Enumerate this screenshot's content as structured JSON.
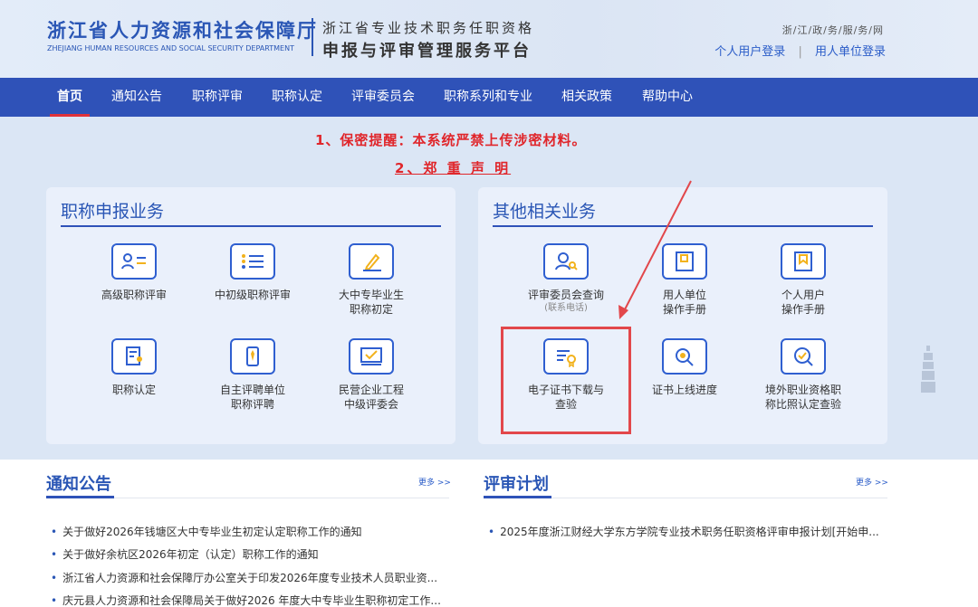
{
  "header": {
    "org_cn": "浙江省人力资源和社会保障厅",
    "org_en": "ZHEJIANG HUMAN RESOURCES AND SOCIAL SECURITY DEPARTMENT",
    "subtitle_line1": "浙江省专业技术职务任职资格",
    "subtitle_line2": "申报与评审管理服务平台",
    "portal_link": "浙/江/政/务/服/务/网",
    "personal_login": "个人用户登录",
    "separator": "|",
    "unit_login": "用人单位登录"
  },
  "nav": {
    "items": [
      {
        "label": "首页"
      },
      {
        "label": "通知公告"
      },
      {
        "label": "职称评审"
      },
      {
        "label": "职称认定"
      },
      {
        "label": "评审委员会"
      },
      {
        "label": "职称系列和专业"
      },
      {
        "label": "相关政策"
      },
      {
        "label": "帮助中心"
      }
    ]
  },
  "notices": {
    "line1": "1、保密提醒：本系统严禁上传涉密材料。",
    "line2": "2、郑 重 声 明"
  },
  "panels": {
    "left": {
      "title": "职称申报业务",
      "items": [
        {
          "label": "高级职称评审",
          "icon": "id-card-icon"
        },
        {
          "label": "中初级职称评审",
          "icon": "list-icon"
        },
        {
          "label": "大中专毕业生\n职称初定",
          "icon": "edit-icon"
        },
        {
          "label": "职称认定",
          "icon": "document-person-icon"
        },
        {
          "label": "自主评聘单位\n职称评聘",
          "icon": "tie-icon"
        },
        {
          "label": "民营企业工程\n中级评委会",
          "icon": "check-board-icon"
        }
      ]
    },
    "right": {
      "title": "其他相关业务",
      "items": [
        {
          "label": "评审委员会查询",
          "note": "(联系电话)",
          "icon": "user-search-icon"
        },
        {
          "label": "用人单位\n操作手册",
          "icon": "book-icon"
        },
        {
          "label": "个人用户\n操作手册",
          "icon": "bookmark-icon"
        },
        {
          "label": "电子证书下载与\n查验",
          "icon": "certificate-icon"
        },
        {
          "label": "证书上线进度",
          "icon": "magnifier-icon"
        },
        {
          "label": "境外职业资格职\n称比照认定查验",
          "icon": "search-check-icon"
        }
      ]
    }
  },
  "sections": {
    "notices": {
      "title": "通知公告",
      "more": "更多 >>",
      "items": [
        "关于做好2026年钱塘区大中专毕业生初定认定职称工作的通知",
        "关于做好余杭区2026年初定（认定）职称工作的通知",
        "浙江省人力资源和社会保障厅办公室关于印发2026年度专业技术人员职业资...",
        "庆元县人力资源和社会保障局关于做好2026 年度大中专毕业生职称初定工作..."
      ]
    },
    "plans": {
      "title": "评审计划",
      "more": "更多 >>",
      "items": [
        "2025年度浙江财经大学东方学院专业技术职务任职资格评审申报计划[开始申..."
      ]
    }
  },
  "colors": {
    "brand_blue": "#2f52b8",
    "alert_red": "#e0262b",
    "highlight_red": "#e2474b"
  }
}
